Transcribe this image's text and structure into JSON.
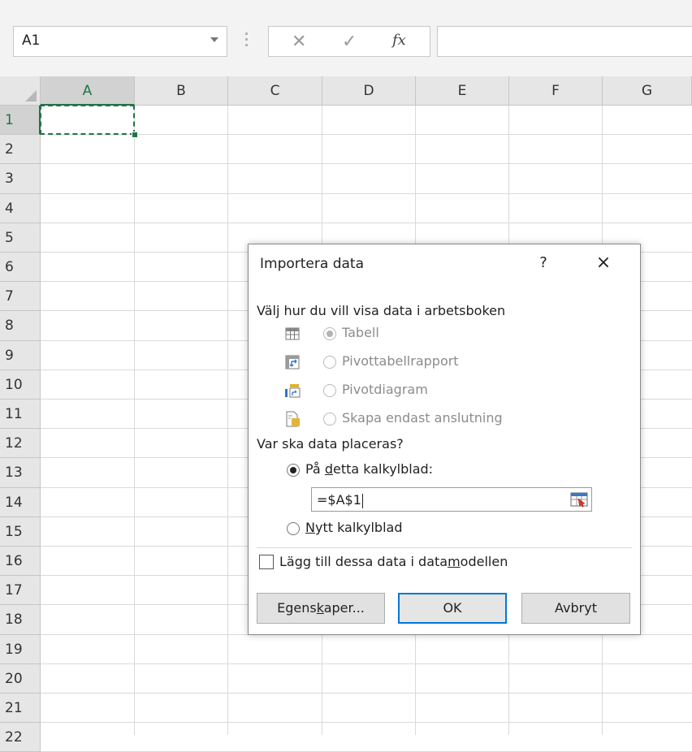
{
  "namebox": {
    "value": "A1"
  },
  "formula_bar": {
    "cancel_icon": "close-icon",
    "enter_icon": "check-icon",
    "fx_label": "fx",
    "value": ""
  },
  "grid": {
    "columns": [
      "A",
      "B",
      "C",
      "D",
      "E",
      "F",
      "G"
    ],
    "rows": [
      "1",
      "2",
      "3",
      "4",
      "5",
      "6",
      "7",
      "8",
      "9",
      "10",
      "11",
      "12",
      "13",
      "14",
      "15",
      "16",
      "17",
      "18",
      "19",
      "20",
      "21",
      "22"
    ],
    "active_cell": "A1"
  },
  "dialog": {
    "title": "Importera data",
    "help_label": "?",
    "close_label": "×",
    "section1_label": "Välj hur du vill visa data i arbetsboken",
    "view_options": [
      {
        "label": "Tabell",
        "checked": true,
        "enabled": false,
        "icon": "table-icon"
      },
      {
        "label": "Pivottabellrapport",
        "checked": false,
        "enabled": false,
        "icon": "pivottable-icon"
      },
      {
        "label": "Pivotdiagram",
        "checked": false,
        "enabled": false,
        "icon": "pivotchart-icon"
      },
      {
        "label": "Skapa endast anslutning",
        "checked": false,
        "enabled": false,
        "icon": "connection-icon"
      }
    ],
    "section2_label": "Var ska data placeras?",
    "existing_sheet": {
      "prefix": "På ",
      "underlined": "d",
      "suffix": "etta kalkylblad:",
      "checked": true
    },
    "reference_value": "=$A$1",
    "new_sheet": {
      "underlined": "N",
      "suffix": "ytt kalkylblad",
      "checked": false
    },
    "data_model": {
      "prefix": "Lägg till dessa data i data",
      "underlined": "m",
      "suffix": "odellen",
      "checked": false
    },
    "buttons": {
      "properties": {
        "prefix": "Egens",
        "underlined": "k",
        "suffix": "aper..."
      },
      "ok": "OK",
      "cancel": "Avbryt"
    }
  }
}
